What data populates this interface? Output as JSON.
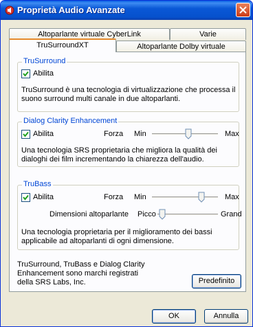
{
  "window": {
    "title": "Proprietà Audio Avanzate"
  },
  "tabs": {
    "back": [
      "Altoparlante virtuale CyberLink",
      "Varie"
    ],
    "front": [
      "TruSurroundXT",
      "Altoparlante Dolby virtuale"
    ]
  },
  "trusurround": {
    "group_label": "TruSurround",
    "enable_label": "Abilita",
    "enabled": true,
    "description": "TruSurround è una tecnologia di virtualizzazione che processa il suono surround multi canale in due altoparlanti."
  },
  "dialog_clarity": {
    "group_label": "Dialog Clarity Enhancement",
    "enable_label": "Abilita",
    "enabled": true,
    "strength_label": "Forza",
    "min_label": "Min",
    "max_label": "Max",
    "slider_value": 0.55,
    "description": "Una tecnologia SRS proprietaria che migliora la qualità dei dialoghi dei film incrementando la chiarezza dell'audio."
  },
  "trubass": {
    "group_label": "TruBass",
    "enable_label": "Abilita",
    "enabled": true,
    "strength_label": "Forza",
    "min_label": "Min",
    "max_label": "Max",
    "strength_value": 0.75,
    "speaker_size_label": "Dimensioni altoparlante",
    "small_label": "Picco",
    "large_label": "Grand",
    "speaker_size_value": 0.08,
    "description": "Una tecnologia proprietaria per il miglioramento dei bassi applicabile ad altoparlanti di ogni dimensione."
  },
  "footer": {
    "trademark": "TruSurround, TruBass e Dialog Clarity Enhancement sono marchi registrati della SRS Labs, Inc.",
    "default_button": "Predefinito"
  },
  "buttons": {
    "ok": "OK",
    "cancel": "Annulla"
  },
  "colors": {
    "title_bar": "#0a58d6",
    "group_label": "#0046d5",
    "selected_tab_accent": "#e68b2c",
    "dialog_bg": "#ece9d8"
  }
}
